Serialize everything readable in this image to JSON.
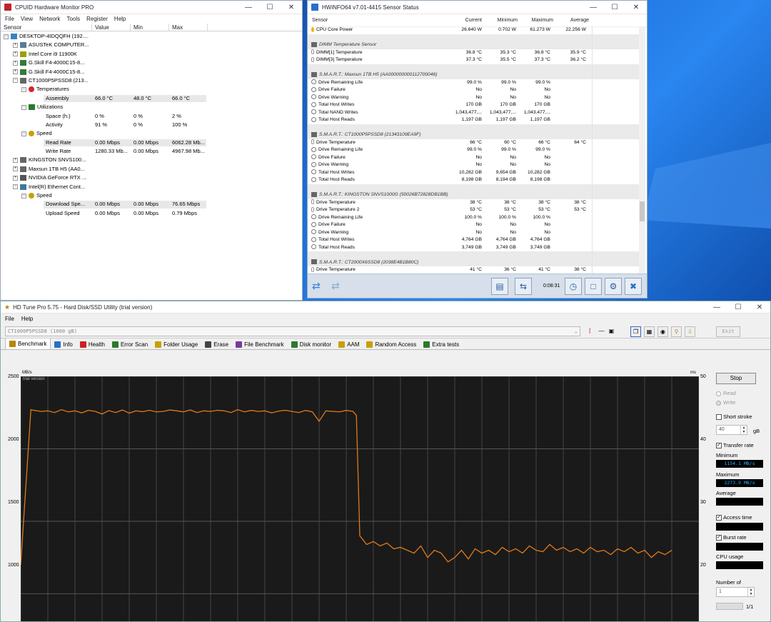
{
  "cpuid": {
    "title": "CPUID Hardware Monitor PRO",
    "menu": [
      "File",
      "View",
      "Network",
      "Tools",
      "Register",
      "Help"
    ],
    "columns": [
      "Sensor",
      "Value",
      "Min",
      "Max"
    ],
    "rows": [
      {
        "level": 0,
        "name": "DESKTOP-4IDQQFH (192....",
        "value": "",
        "min": "",
        "max": "",
        "exp": "-",
        "icon": "computer-icon"
      },
      {
        "level": 1,
        "name": "ASUSTeK COMPUTER...",
        "value": "",
        "min": "",
        "max": "",
        "exp": "+",
        "icon": "motherboard-icon"
      },
      {
        "level": 1,
        "name": "Intel Core i9 11900K",
        "value": "",
        "min": "",
        "max": "",
        "exp": "+",
        "icon": "cpu-icon"
      },
      {
        "level": 1,
        "name": "G.Skill F4-4000C15-8...",
        "value": "",
        "min": "",
        "max": "",
        "exp": "+",
        "icon": "memory-icon"
      },
      {
        "level": 1,
        "name": "G.Skill F4-4000C15-8...",
        "value": "",
        "min": "",
        "max": "",
        "exp": "+",
        "icon": "memory-icon"
      },
      {
        "level": 1,
        "name": "CT1000P5PSSD8 (213...",
        "value": "",
        "min": "",
        "max": "",
        "exp": "-",
        "icon": "drive-icon"
      },
      {
        "level": 2,
        "name": "Temperatures",
        "value": "",
        "min": "",
        "max": "",
        "exp": "-",
        "icon": "thermometer-icon"
      },
      {
        "level": 3,
        "name": "Assembly",
        "value": "66.0 °C",
        "min": "48.0 °C",
        "max": "66.0 °C",
        "hl": true
      },
      {
        "level": 2,
        "name": "Utilizations",
        "value": "",
        "min": "",
        "max": "",
        "exp": "-",
        "icon": "utilization-icon"
      },
      {
        "level": 3,
        "name": "Space (h:)",
        "value": "0 %",
        "min": "0 %",
        "max": "2 %"
      },
      {
        "level": 3,
        "name": "Activity",
        "value": "91 %",
        "min": "0 %",
        "max": "100 %"
      },
      {
        "level": 2,
        "name": "Speed",
        "value": "",
        "min": "",
        "max": "",
        "exp": "-",
        "icon": "speed-icon"
      },
      {
        "level": 3,
        "name": "Read Rate",
        "value": "0.00 Mbps",
        "min": "0.00 Mbps",
        "max": "6062.28 Mb...",
        "hl": true
      },
      {
        "level": 3,
        "name": "Write Rate",
        "value": "1280.33 Mb...",
        "min": "0.00 Mbps",
        "max": "4967.98 Mb..."
      },
      {
        "level": 1,
        "name": "KINGSTON SNVS100...",
        "value": "",
        "min": "",
        "max": "",
        "exp": "+",
        "icon": "drive-icon"
      },
      {
        "level": 1,
        "name": "Maxsun  1TB H5 (AA0...",
        "value": "",
        "min": "",
        "max": "",
        "exp": "+",
        "icon": "drive-icon"
      },
      {
        "level": 1,
        "name": "NVIDIA GeForce RTX ...",
        "value": "",
        "min": "",
        "max": "",
        "exp": "+",
        "icon": "gpu-icon"
      },
      {
        "level": 1,
        "name": "Intel(R) Ethernet Cont...",
        "value": "",
        "min": "",
        "max": "",
        "exp": "-",
        "icon": "network-icon"
      },
      {
        "level": 2,
        "name": "Speed",
        "value": "",
        "min": "",
        "max": "",
        "exp": "-",
        "icon": "speed-icon"
      },
      {
        "level": 3,
        "name": "Download Spe...",
        "value": "0.00 Mbps",
        "min": "0.00 Mbps",
        "max": "76.65 Mbps",
        "hl": true
      },
      {
        "level": 3,
        "name": "Upload Speed",
        "value": "0.00 Mbps",
        "min": "0.00 Mbps",
        "max": "0.79 Mbps"
      }
    ]
  },
  "hwinfo": {
    "title": "HWiNFO64 v7.01-4415 Sensor Status",
    "columns": [
      "Sensor",
      "Current",
      "Minimum",
      "Maximum",
      "Average"
    ],
    "rows": [
      {
        "t": "row",
        "name": "CPU Core Power",
        "cur": "26.640 W",
        "min": "0.702 W",
        "max": "61.273 W",
        "avg": "22.256 W",
        "icon": "power"
      },
      {
        "t": "gap"
      },
      {
        "t": "group",
        "name": "DIMM Temperature Sensor"
      },
      {
        "t": "row",
        "name": "DIMM[1] Temperature",
        "cur": "36.8 °C",
        "min": "35.3 °C",
        "max": "36.8 °C",
        "avg": "35.9 °C",
        "icon": "temp"
      },
      {
        "t": "row",
        "name": "DIMM[3] Temperature",
        "cur": "37.3 °C",
        "min": "35.5 °C",
        "max": "37.3 °C",
        "avg": "36.2 °C",
        "icon": "temp"
      },
      {
        "t": "gap"
      },
      {
        "t": "group",
        "name": "S.M.A.R.T.: Maxsun  1TB H5 (AA000000000112700046)"
      },
      {
        "t": "row",
        "name": "Drive Remaining Life",
        "cur": "99.0 %",
        "min": "99.0 %",
        "max": "99.0 %",
        "avg": "",
        "icon": "circle"
      },
      {
        "t": "row",
        "name": "Drive Failure",
        "cur": "No",
        "min": "No",
        "max": "No",
        "avg": "",
        "icon": "circle"
      },
      {
        "t": "row",
        "name": "Drive Warning",
        "cur": "No",
        "min": "No",
        "max": "No",
        "avg": "",
        "icon": "circle"
      },
      {
        "t": "row",
        "name": "Total Host Writes",
        "cur": "170 GB",
        "min": "170 GB",
        "max": "170 GB",
        "avg": "",
        "icon": "circle"
      },
      {
        "t": "row",
        "name": "Total NAND Writes",
        "cur": "1,043,477,...",
        "min": "1,043,477,...",
        "max": "1,043,477,...",
        "avg": "",
        "icon": "circle"
      },
      {
        "t": "row",
        "name": "Total Host Reads",
        "cur": "1,197 GB",
        "min": "1,197 GB",
        "max": "1,197 GB",
        "avg": "",
        "icon": "circle"
      },
      {
        "t": "gap"
      },
      {
        "t": "group",
        "name": "S.M.A.R.T.: CT1000P5PSSD8 (21343109EA9F)"
      },
      {
        "t": "row",
        "name": "Drive Temperature",
        "cur": "66 °C",
        "min": "60 °C",
        "max": "66 °C",
        "avg": "64 °C",
        "icon": "temp"
      },
      {
        "t": "row",
        "name": "Drive Remaining Life",
        "cur": "99.0 %",
        "min": "99.0 %",
        "max": "99.0 %",
        "avg": "",
        "icon": "circle"
      },
      {
        "t": "row",
        "name": "Drive Failure",
        "cur": "No",
        "min": "No",
        "max": "No",
        "avg": "",
        "icon": "circle"
      },
      {
        "t": "row",
        "name": "Drive Warning",
        "cur": "No",
        "min": "No",
        "max": "No",
        "avg": "",
        "icon": "circle"
      },
      {
        "t": "row",
        "name": "Total Host Writes",
        "cur": "10,282 GB",
        "min": "9,654 GB",
        "max": "10,282 GB",
        "avg": "",
        "icon": "circle"
      },
      {
        "t": "row",
        "name": "Total Host Reads",
        "cur": "8,198 GB",
        "min": "8,194 GB",
        "max": "8,198 GB",
        "avg": "",
        "icon": "circle"
      },
      {
        "t": "gap"
      },
      {
        "t": "group",
        "name": "S.M.A.R.T.: KINGSTON SNVS1000G (50026B72828DB1BB)"
      },
      {
        "t": "row",
        "name": "Drive Temperature",
        "cur": "38 °C",
        "min": "38 °C",
        "max": "38 °C",
        "avg": "38 °C",
        "icon": "temp"
      },
      {
        "t": "row",
        "name": "Drive Temperature 2",
        "cur": "53 °C",
        "min": "53 °C",
        "max": "53 °C",
        "avg": "53 °C",
        "icon": "temp"
      },
      {
        "t": "row",
        "name": "Drive Remaining Life",
        "cur": "100.0 %",
        "min": "100.0 %",
        "max": "100.0 %",
        "avg": "",
        "icon": "circle"
      },
      {
        "t": "row",
        "name": "Drive Failure",
        "cur": "No",
        "min": "No",
        "max": "No",
        "avg": "",
        "icon": "circle"
      },
      {
        "t": "row",
        "name": "Drive Warning",
        "cur": "No",
        "min": "No",
        "max": "No",
        "avg": "",
        "icon": "circle"
      },
      {
        "t": "row",
        "name": "Total Host Writes",
        "cur": "4,764 GB",
        "min": "4,764 GB",
        "max": "4,764 GB",
        "avg": "",
        "icon": "circle"
      },
      {
        "t": "row",
        "name": "Total Host Reads",
        "cur": "3,749 GB",
        "min": "3,749 GB",
        "max": "3,749 GB",
        "avg": "",
        "icon": "circle"
      },
      {
        "t": "gap"
      },
      {
        "t": "group",
        "name": "S.M.A.R.T.: CT2000X6SSD8 (2038E4B1B80C)"
      },
      {
        "t": "row",
        "name": "Drive Temperature",
        "cur": "41 °C",
        "min": "36 °C",
        "max": "41 °C",
        "avg": "38 °C",
        "icon": "temp"
      }
    ],
    "timer": "0:08:31"
  },
  "hdtune": {
    "title": "HD Tune Pro 5.75 - Hard Disk/SSD Utility (trial version)",
    "menu": [
      "File",
      "Help"
    ],
    "drive": "CT1000P5PSSD8 (1000 gB)",
    "exit_label": "Exit",
    "tabs": [
      "Benchmark",
      "Info",
      "Health",
      "Error Scan",
      "Folder Usage",
      "Erase",
      "File Benchmark",
      "Disk monitor",
      "AAM",
      "Random Access",
      "Extra tests"
    ],
    "side": {
      "stop": "Stop",
      "read": "Read",
      "write": "Write",
      "short_stroke": "Short stroke",
      "short_stroke_value": "40",
      "unit_gb": "gB",
      "transfer_rate": "Transfer rate",
      "minimum": "Minimum",
      "minimum_value": "1154.1 MB/s",
      "maximum": "Maximum",
      "maximum_value": "2273.9 MB/s",
      "average": "Average",
      "access_time": "Access time",
      "burst_rate": "Burst rate",
      "cpu_usage": "CPU usage",
      "number_of": "Number of",
      "number_value": "1",
      "progress": "1/1"
    }
  },
  "chart_data": {
    "type": "line",
    "title": "",
    "watermark": "trial version",
    "ylabel": "MB/s",
    "y2label": "ms",
    "yticks": [
      "2500",
      "2000",
      "1500",
      "1000"
    ],
    "y2ticks": [
      "50",
      "40",
      "30",
      "20"
    ],
    "ylim": [
      800,
      2500
    ],
    "xlim": [
      0,
      100
    ],
    "color": "#e07a1a",
    "series": [
      {
        "x": [
          0,
          1.5,
          2,
          3,
          4,
          5,
          6,
          7,
          8,
          9,
          10,
          11,
          12,
          13,
          14,
          15,
          16,
          17,
          18,
          19,
          20,
          21,
          22,
          23,
          24,
          25,
          26,
          27,
          28,
          29,
          30,
          31,
          32,
          33,
          34,
          35,
          36,
          37,
          38,
          39,
          40,
          41,
          42,
          43,
          44,
          45,
          46,
          47,
          48,
          49,
          49.5,
          50,
          51,
          52,
          53,
          54,
          55,
          56,
          57,
          58,
          59,
          60,
          61,
          62,
          63,
          64,
          65,
          66,
          67,
          68,
          69,
          70,
          71,
          72,
          73,
          74,
          75,
          76,
          77,
          78,
          79,
          80,
          81,
          82,
          83,
          84,
          85,
          86,
          87,
          88,
          89,
          90,
          91,
          92,
          93,
          94,
          95,
          96
        ],
        "y": [
          1200,
          2270,
          2265,
          2258,
          2262,
          2250,
          2270,
          2255,
          2262,
          2248,
          2266,
          2258,
          2240,
          2264,
          2250,
          2268,
          2246,
          2262,
          2256,
          2266,
          2255,
          2258,
          2268,
          2262,
          2255,
          2268,
          2250,
          2262,
          2258,
          2266,
          2262,
          2250,
          2270,
          2255,
          2265,
          2258,
          2262,
          2248,
          2260,
          2266,
          2258,
          2250,
          2265,
          2255,
          2190,
          2262,
          2258,
          2255,
          2265,
          2258,
          2230,
          1400,
          1340,
          1360,
          1330,
          1350,
          1310,
          1320,
          1300,
          1280,
          1330,
          1250,
          1300,
          1280,
          1220,
          1250,
          1300,
          1240,
          1310,
          1280,
          1300,
          1270,
          1320,
          1290,
          1310,
          1280,
          1330,
          1300,
          1290,
          1340,
          1300,
          1320,
          1290,
          1310,
          1280,
          1320,
          1290,
          1300,
          1270,
          1310,
          1290,
          1320,
          1280,
          1300,
          1250,
          1290,
          1270,
          1300
        ]
      }
    ]
  }
}
